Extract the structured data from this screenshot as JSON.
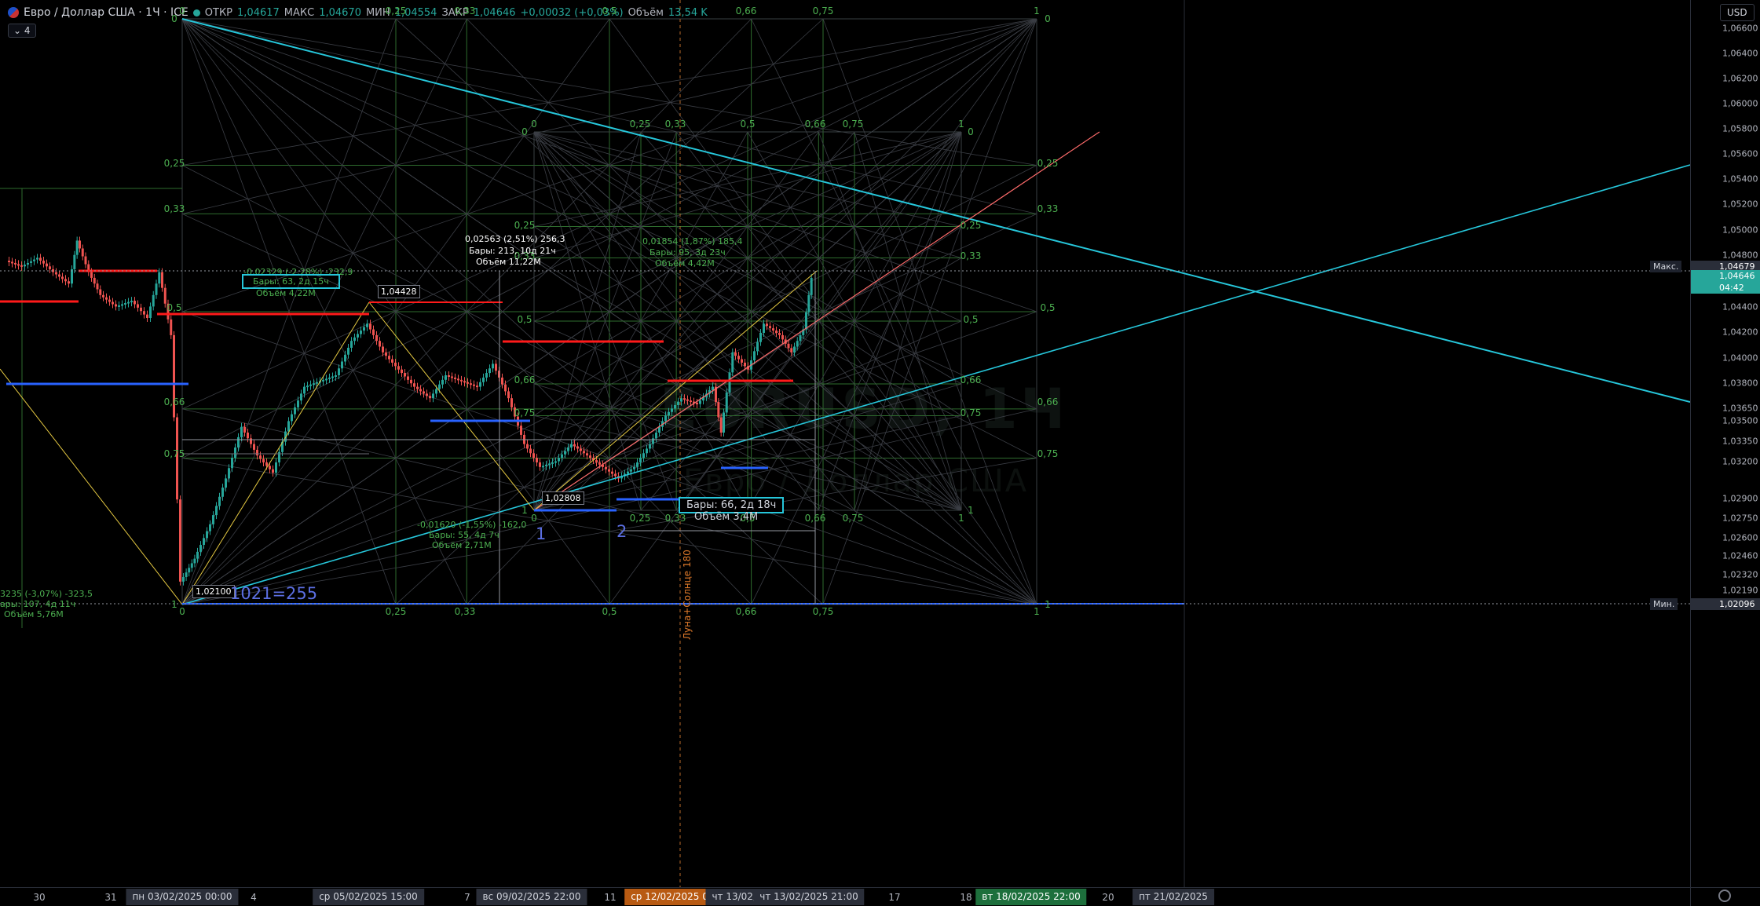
{
  "legend": {
    "symbol": "Евро / Доллар США · 1Ч · ICE",
    "open_label": "ОТКР",
    "open_value": "1,04617",
    "high_label": "МАКС",
    "high_value": "1,04670",
    "low_label": "МИН",
    "low_value": "1,04554",
    "close_label": "ЗАКР",
    "close_value": "1,04646",
    "change": "+0,00032 (+0,03%)",
    "volume_label": "Объём",
    "volume_value": "13,54 K",
    "collapse_label": "4"
  },
  "currency": "USD",
  "watermark": {
    "line1": "EURUSD, 1Ч",
    "line2": "Евро / Доллар США"
  },
  "price_axis": {
    "ticks": [
      "1,06600",
      "1,06400",
      "1,06200",
      "1,06000",
      "1,05800",
      "1,05600",
      "1,05400",
      "1,05200",
      "1,05000",
      "1,04800",
      "1,04400",
      "1,04200",
      "1,04000",
      "1,03800",
      "1,03650",
      "1,03500",
      "1,03350",
      "1,03200",
      "1,02900",
      "1,02750",
      "1,02600",
      "1,02460",
      "1,02320",
      "1,02190"
    ],
    "max_label": "Макс.",
    "max_value": "1,04679",
    "current_value": "1,04646",
    "current_timer": "04:42",
    "min_label": "Мин.",
    "min_value": "1,02096"
  },
  "time_axis": {
    "labels": [
      "30",
      "31",
      "4",
      "5",
      "7",
      "11",
      "17",
      "18",
      "20"
    ],
    "boxes": [
      "пн 03/02/2025   00:00",
      "ср 05/02/2025   15:00",
      "вс 09/02/2025   22:00",
      "ср 12/02/2025   00:00",
      "чт 13/02/2025",
      "00:",
      "чт 13/02/2025   21:00",
      "вт 18/02/2025   22:00",
      "пт 21/02/2025"
    ]
  },
  "fib_levels": [
    "0",
    "0,25",
    "0,33",
    "0,5",
    "0,66",
    "0,75",
    "1"
  ],
  "drawing_labels": {
    "left_price": "1,02100",
    "top_price": "1,04428",
    "mid_price": "1,02808",
    "big_count": "1021=255",
    "point1": "1",
    "point2": "2",
    "astro": "Луна+Солнце 180",
    "m1_l1": "0,02563 (2,51%) 256,3",
    "m1_l2": "Бары: 213, 10д 21ч",
    "m1_l3": "Объём 11,22M",
    "m2_l1": "0,01854 (1,87%) 185,4",
    "m2_l2": "Бары: 95, 3д 23ч",
    "m2_l3": "Объём 4,42M",
    "m3_l1": "-0,02329 (-2,28%) -232,9",
    "m3_l2": "Бары: 63, 2д 15ч",
    "m3_l3": "Объём 4,22M",
    "m4_l1": "-0,01620 (-1,55%) -162,0",
    "m4_l2": "Бары: 55, 4д 7ч",
    "m4_l3": "Объём 2,71M",
    "m5_l1": "Бары: 66, 2д 18ч",
    "m5_l2": "Объём 3,4M",
    "m6_l1": "3235 (-3,07%) -323,5",
    "m6_l2": "ары: 107, 4д 11ч",
    "m6_l3": "Объём 5,76M"
  },
  "colors": {
    "up": "#26a69a",
    "down": "#ef5350",
    "cyan": "#26c6da",
    "red_level": "#ff1a1a",
    "blue_level": "#2962ff",
    "fib": "#4caf50",
    "yellow": "#e5c942",
    "current": "#26a69a"
  }
}
